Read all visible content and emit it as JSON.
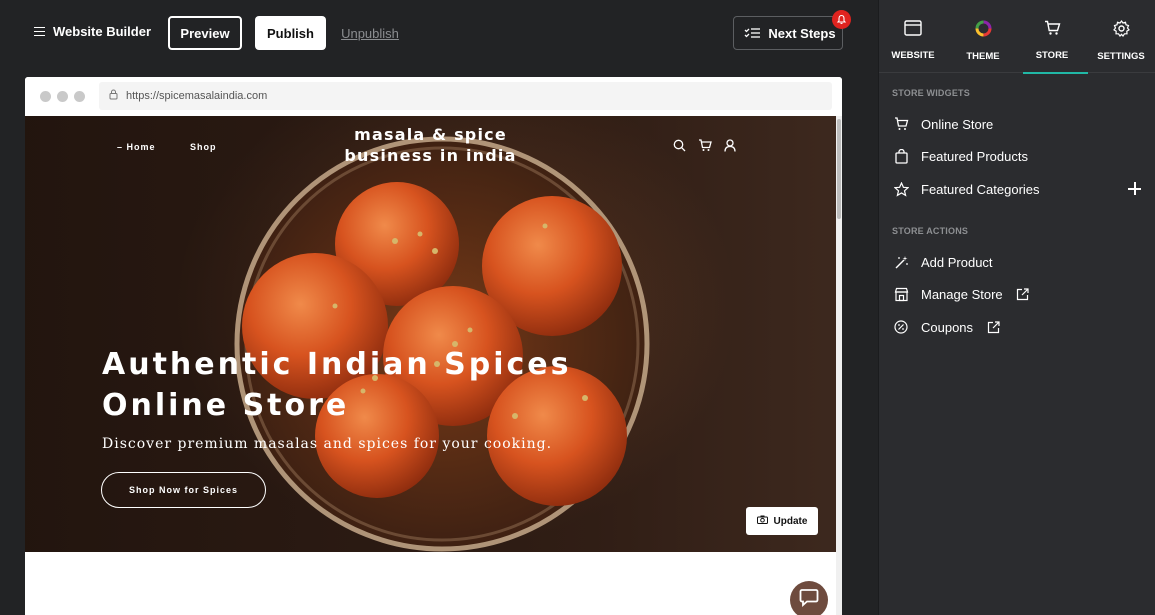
{
  "topbar": {
    "app_title": "Website Builder",
    "preview_label": "Preview",
    "publish_label": "Publish",
    "unpublish_label": "Unpublish",
    "next_steps_label": "Next Steps"
  },
  "browser": {
    "url": "https://spicemasalaindia.com"
  },
  "site": {
    "nav_home": "– Home",
    "nav_shop": "Shop",
    "title_line1": "masala & spice",
    "title_line2": "business in india",
    "headline_line1": "Authentic Indian Spices",
    "headline_line2": "Online Store",
    "subline": "Discover premium masalas and spices for your cooking.",
    "cta": "Shop Now for Spices",
    "update_label": "Update"
  },
  "panel": {
    "tabs": [
      {
        "label": "WEBSITE",
        "icon": "browser-icon"
      },
      {
        "label": "THEME",
        "icon": "color-wheel-icon"
      },
      {
        "label": "STORE",
        "icon": "cart-icon"
      },
      {
        "label": "SETTINGS",
        "icon": "gear-icon"
      }
    ],
    "active_tab": "STORE",
    "widgets_heading": "STORE WIDGETS",
    "widgets": [
      {
        "label": "Online Store",
        "icon": "cart-icon"
      },
      {
        "label": "Featured Products",
        "icon": "shopping-bag-icon"
      },
      {
        "label": "Featured Categories",
        "icon": "star-icon"
      }
    ],
    "actions_heading": "STORE ACTIONS",
    "actions": [
      {
        "label": "Add Product",
        "icon": "magic-wand-icon"
      },
      {
        "label": "Manage Store",
        "icon": "storefront-icon"
      },
      {
        "label": "Coupons",
        "icon": "coupon-icon"
      }
    ]
  },
  "colors": {
    "app_bg": "#222325",
    "panel_bg": "#2b2c2f",
    "accent": "#21b8a6",
    "notification": "#e0231f",
    "chat_button": "#6e4b3e"
  }
}
